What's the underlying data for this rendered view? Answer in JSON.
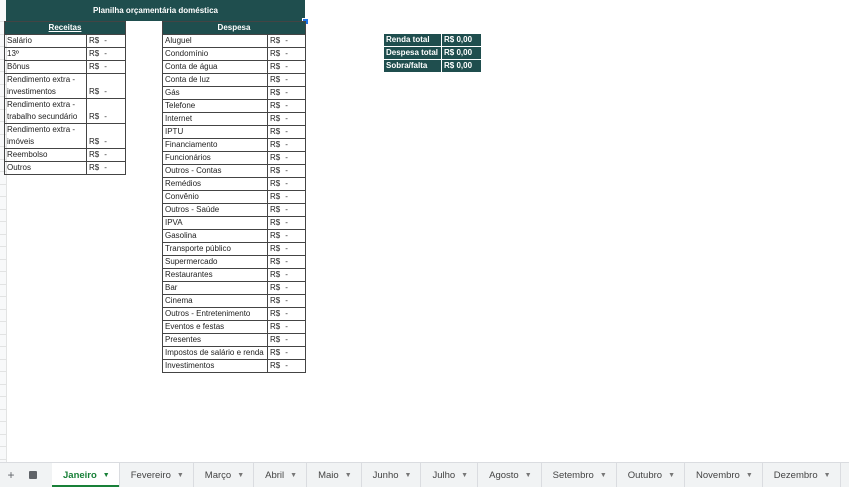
{
  "title": "Planilha orçamentária doméstica",
  "currency": "R$",
  "dash": "-",
  "receitas": {
    "header": "Receitas",
    "rows": [
      {
        "label": "Salário"
      },
      {
        "label": "13º"
      },
      {
        "label": "Bônus"
      },
      {
        "label": "Rendimento extra - investimentos"
      },
      {
        "label": "Rendimento extra - trabalho secundário"
      },
      {
        "label": "Rendimento extra - imóveis"
      },
      {
        "label": "Reembolso"
      },
      {
        "label": "Outros"
      }
    ]
  },
  "despesa": {
    "header": "Despesa",
    "rows": [
      {
        "label": "Aluguel"
      },
      {
        "label": "Condomínio"
      },
      {
        "label": "Conta de água"
      },
      {
        "label": "Conta de luz"
      },
      {
        "label": "Gás"
      },
      {
        "label": "Telefone"
      },
      {
        "label": "Internet"
      },
      {
        "label": "IPTU"
      },
      {
        "label": "Financiamento"
      },
      {
        "label": "Funcionários"
      },
      {
        "label": "Outros - Contas"
      },
      {
        "label": "Remédios"
      },
      {
        "label": "Convênio"
      },
      {
        "label": "Outros - Saúde"
      },
      {
        "label": "IPVA"
      },
      {
        "label": "Gasolina"
      },
      {
        "label": "Transporte público"
      },
      {
        "label": "Supermercado"
      },
      {
        "label": "Restaurantes"
      },
      {
        "label": "Bar"
      },
      {
        "label": "Cinema"
      },
      {
        "label": "Outros - Entretenimento"
      },
      {
        "label": "Eventos e festas"
      },
      {
        "label": "Presentes"
      },
      {
        "label": "Impostos de salário e renda"
      },
      {
        "label": "Investimentos"
      }
    ]
  },
  "summary": [
    {
      "label": "Renda total",
      "value": "R$ 0,00"
    },
    {
      "label": "Despesa total",
      "value": "R$ 0,00"
    },
    {
      "label": "Sobra/falta",
      "value": "R$ 0,00"
    }
  ],
  "sheet_tabs": {
    "add_icon": "plus-icon",
    "list_icon": "sheet-list-icon",
    "active": "Janeiro",
    "tabs": [
      "Janeiro",
      "Fevereiro",
      "Março",
      "Abril",
      "Maio",
      "Junho",
      "Julho",
      "Agosto",
      "Setembro",
      "Outubro",
      "Novembro",
      "Dezembro"
    ]
  },
  "colors": {
    "header_bg": "#1f4e4e",
    "active_tab": "#188038"
  }
}
